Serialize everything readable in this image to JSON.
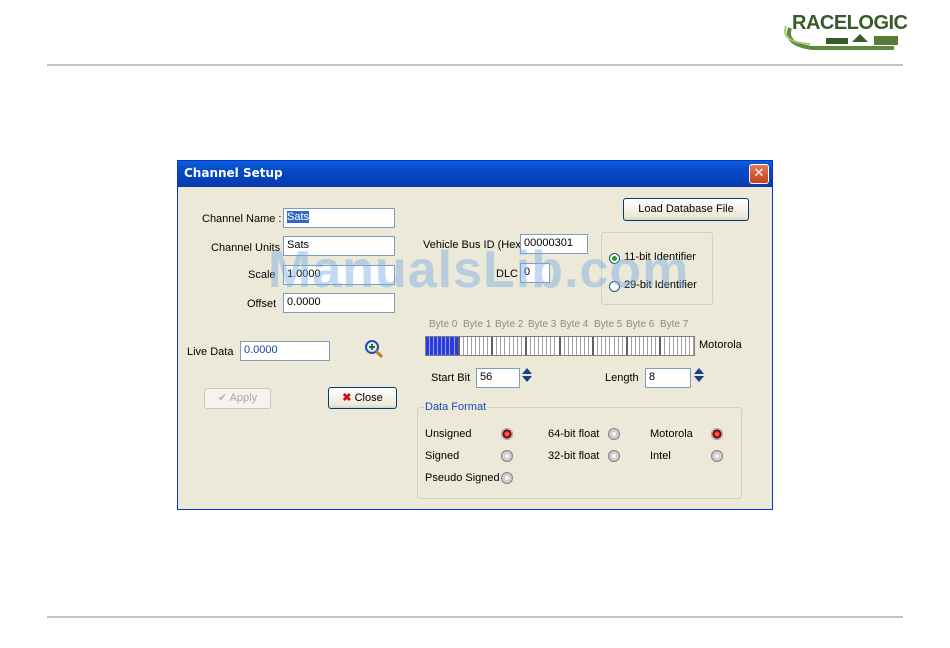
{
  "brand": {
    "name": "RACELOGIC"
  },
  "watermark": "ManualsLib.com",
  "dialog": {
    "title": "Channel Setup",
    "close_glyph": "✕",
    "fields": {
      "channel_name_label": "Channel Name :",
      "channel_name_value": "Sats",
      "channel_units_label": "Channel Units",
      "channel_units_value": "Sats",
      "scale_label": "Scale",
      "scale_value": "1.0000",
      "offset_label": "Offset",
      "offset_value": "0.0000",
      "live_data_label": "Live Data",
      "live_data_value": "0.0000",
      "vehicle_bus_id_label": "Vehicle Bus ID (Hex)",
      "vehicle_bus_id_value": "00000301",
      "dlc_label": "DLC",
      "dlc_value": "0",
      "start_bit_label": "Start Bit",
      "start_bit_value": "56",
      "length_label": "Length",
      "length_value": "8"
    },
    "buttons": {
      "load_db": "Load Database File",
      "apply": "Apply",
      "close": "Close"
    },
    "identifier": {
      "opt11": "11-bit Identifier",
      "opt29": "29-bit Identifier",
      "selected": "11-bit Identifier"
    },
    "bytes": [
      "Byte 0",
      "Byte 1",
      "Byte 2",
      "Byte 3",
      "Byte 4",
      "Byte 5",
      "Byte 6",
      "Byte 7"
    ],
    "byte_order_label": "Motorola",
    "data_format": {
      "legend": "Data Format",
      "unsigned": "Unsigned",
      "signed": "Signed",
      "pseudo_signed": "Pseudo Signed",
      "float64": "64-bit float",
      "float32": "32-bit float",
      "motorola": "Motorola",
      "intel": "Intel",
      "selected_type": "Unsigned",
      "selected_order": "Motorola"
    }
  },
  "icons": {
    "zoom": "magnifier-plus-icon",
    "apply": "checkmark-icon",
    "close": "red-x-icon"
  }
}
